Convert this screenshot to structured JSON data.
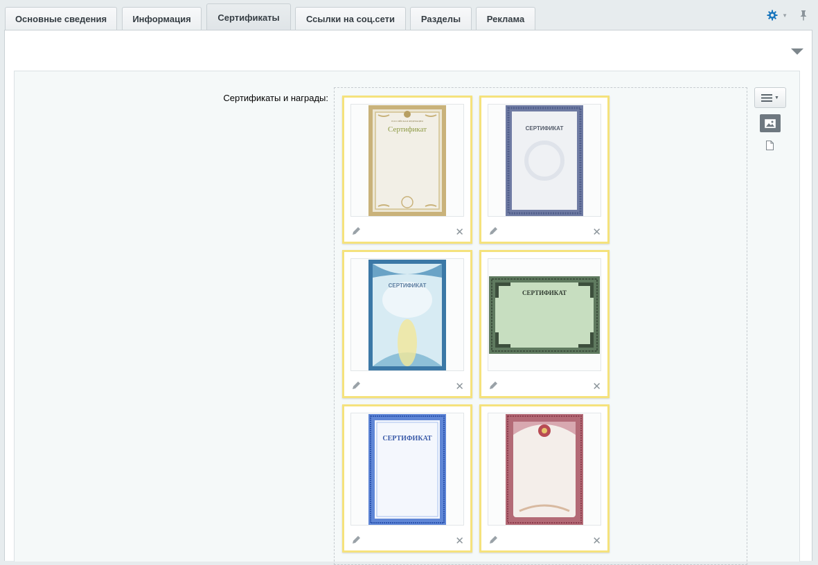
{
  "tabs": [
    {
      "label": "Основные сведения",
      "active": false
    },
    {
      "label": "Информация",
      "active": false
    },
    {
      "label": "Сертификаты",
      "active": true
    },
    {
      "label": "Ссылки на соц.сети",
      "active": false
    },
    {
      "label": "Разделы",
      "active": false
    },
    {
      "label": "Реклама",
      "active": false
    }
  ],
  "toolbar": {
    "icons": [
      "gear-icon",
      "chevron-down-icon",
      "pin-icon"
    ]
  },
  "section": {
    "collapse_icon": "triangle-down-icon"
  },
  "field": {
    "label": "Сертификаты и награды:"
  },
  "certificates": [
    {
      "title": "Сертификат",
      "style": "gold-classic",
      "orientation": "portrait",
      "subtitle": "РОССИЙСКАЯ ФЕДЕРАЦИЯ"
    },
    {
      "title": "СЕРТИФИКАТ",
      "style": "blue-gray",
      "orientation": "portrait"
    },
    {
      "title": "СЕРТИФИКАТ",
      "style": "blue-yellow",
      "orientation": "portrait"
    },
    {
      "title": "СЕРТИФИКАТ",
      "style": "green",
      "orientation": "landscape"
    },
    {
      "title": "СЕРТИФИКАТ",
      "style": "blue-frame",
      "orientation": "portrait"
    },
    {
      "title": "",
      "style": "red-coat",
      "orientation": "portrait"
    }
  ],
  "card_actions": {
    "edit_icon": "pencil-icon",
    "delete_icon": "close-icon"
  },
  "view_controls": {
    "menu_icon": "menu-icon",
    "image_view_icon": "image-icon",
    "file_view_icon": "file-icon"
  },
  "colors": {
    "accent_border": "#f5e27c",
    "gear": "#1a76bd"
  }
}
